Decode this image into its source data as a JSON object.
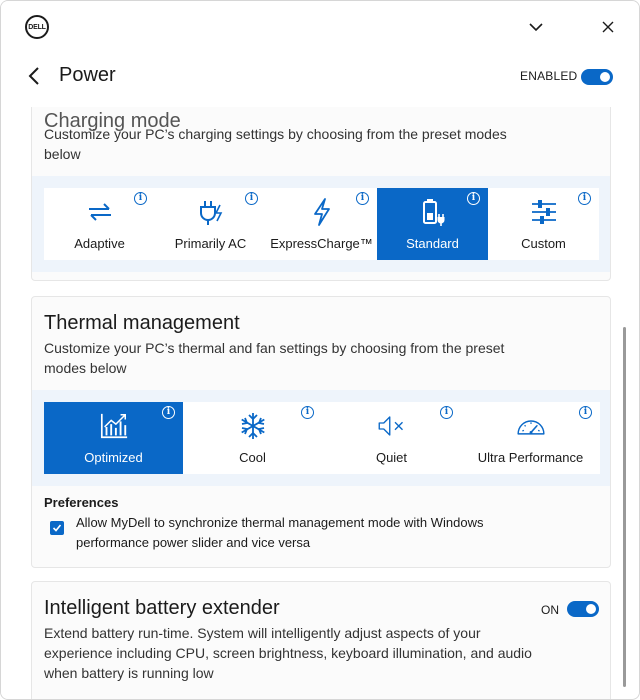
{
  "window": {
    "logo_text": "DELL"
  },
  "header": {
    "title": "Power",
    "enabled_label": "ENABLED",
    "enabled": true
  },
  "charging": {
    "title": "Charging mode",
    "description": "Customize your PC’s charging settings by choosing from the preset modes below",
    "modes": [
      {
        "label": "Adaptive",
        "icon": "adaptive-arrows-icon",
        "selected": false
      },
      {
        "label": "Primarily AC",
        "icon": "ac-plug-icon",
        "selected": false
      },
      {
        "label": "ExpressCharge™",
        "icon": "lightning-icon",
        "selected": false
      },
      {
        "label": "Standard",
        "icon": "battery-plug-icon",
        "selected": true
      },
      {
        "label": "Custom",
        "icon": "sliders-icon",
        "selected": false
      }
    ]
  },
  "thermal": {
    "title": "Thermal management",
    "description": "Customize your PC’s thermal and fan settings by choosing from the preset modes below",
    "modes": [
      {
        "label": "Optimized",
        "icon": "chart-icon",
        "selected": true
      },
      {
        "label": "Cool",
        "icon": "snowflake-icon",
        "selected": false
      },
      {
        "label": "Quiet",
        "icon": "speaker-mute-icon",
        "selected": false
      },
      {
        "label": "Ultra Performance",
        "icon": "speedometer-icon",
        "selected": false
      }
    ],
    "preferences_title": "Preferences",
    "sync_text": "Allow MyDell to synchronize thermal management mode with Windows performance power slider and vice versa",
    "sync_checked": true
  },
  "battery_extender": {
    "title": "Intelligent battery extender",
    "on_label": "ON",
    "on": true,
    "description": "Extend battery run-time. System will intelligently adjust aspects of your experience including CPU, screen brightness, keyboard illumination, and audio when battery is running low"
  },
  "colors": {
    "accent": "#0a68c7",
    "band": "#eef4fb"
  }
}
